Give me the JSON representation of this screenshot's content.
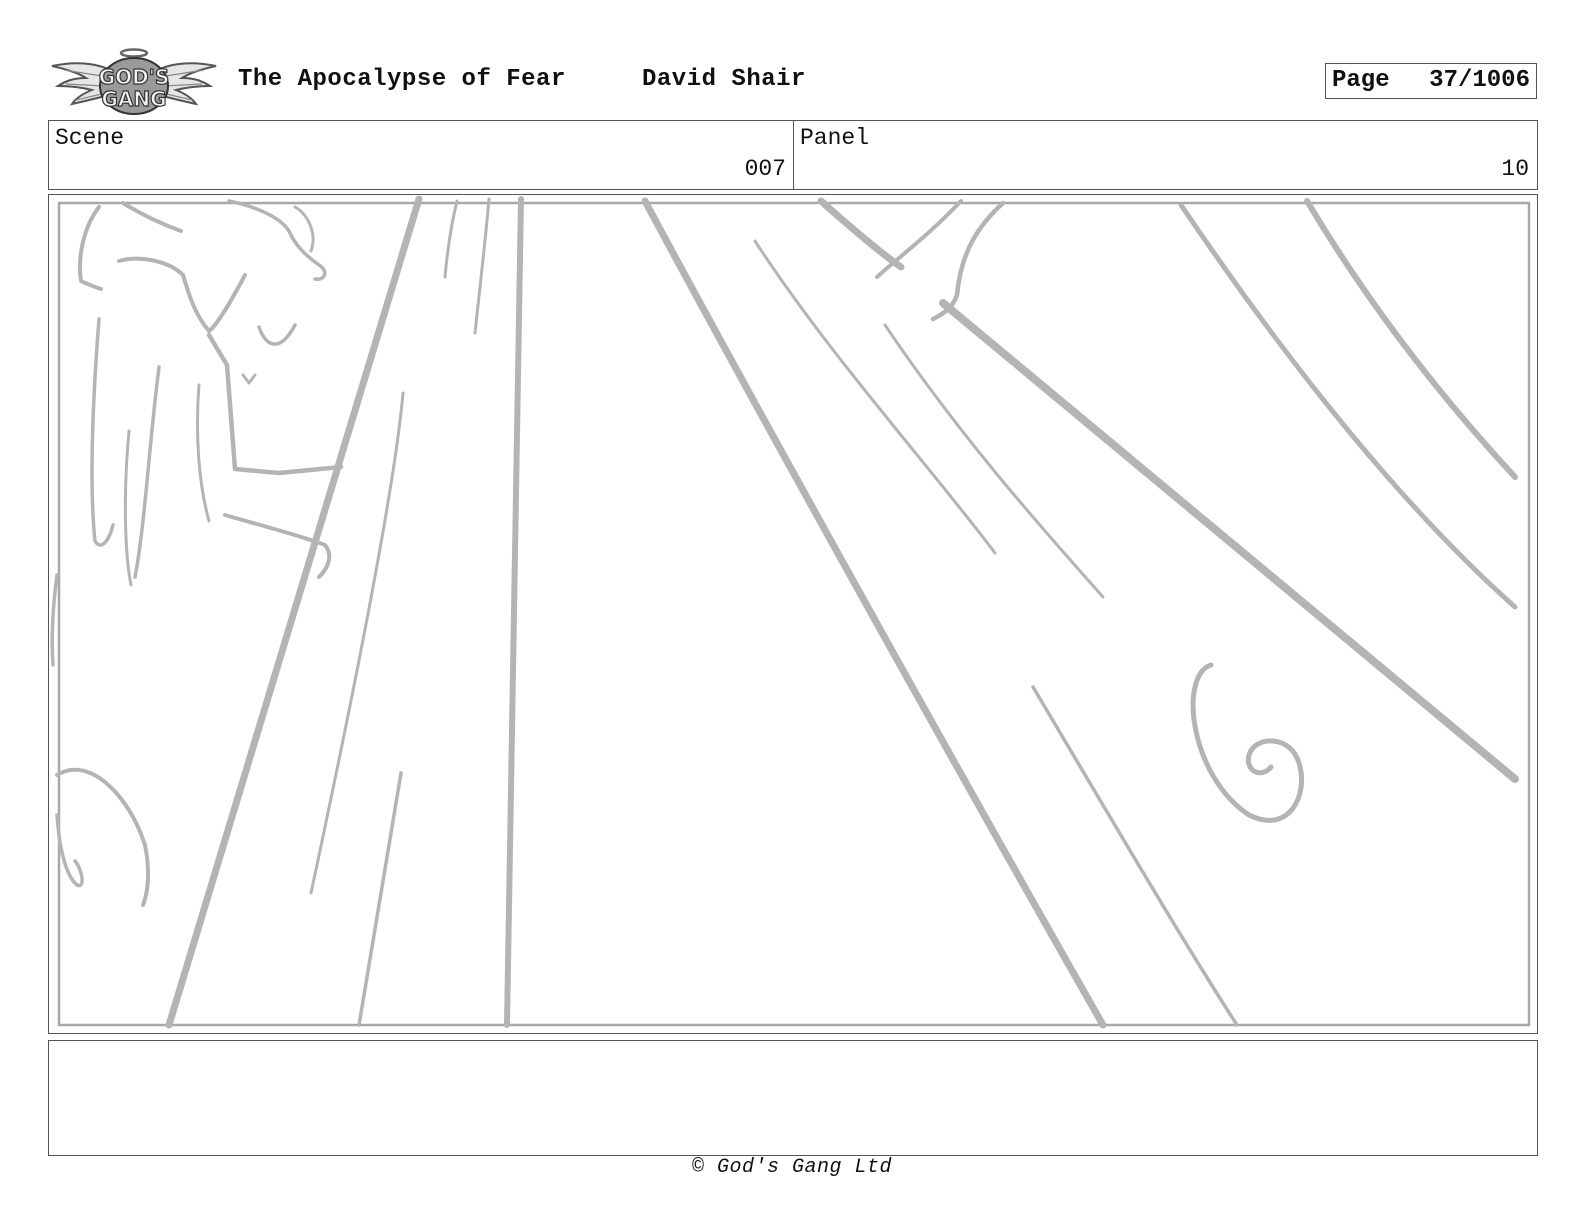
{
  "header": {
    "logo_text": "GOD'S GANG",
    "title": "The Apocalypse of Fear",
    "author": "David Shair",
    "page_label": "Page",
    "page_value": "37/1006"
  },
  "info": {
    "scene_label": "Scene",
    "scene_value": "007",
    "panel_label": "Panel",
    "panel_value": "10"
  },
  "notes": {
    "text": ""
  },
  "footer": {
    "copyright": "© God's Gang Ltd"
  },
  "colors": {
    "sketch_stroke": "#b4b4b4",
    "border": "#555555"
  }
}
